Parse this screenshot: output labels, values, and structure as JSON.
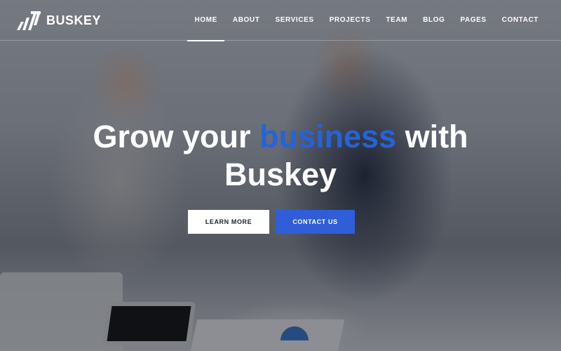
{
  "brand": {
    "name": "BUSKEY"
  },
  "nav": {
    "items": [
      {
        "label": "HOME",
        "active": true
      },
      {
        "label": "ABOUT",
        "active": false
      },
      {
        "label": "SERVICES",
        "active": false
      },
      {
        "label": "PROJECTS",
        "active": false
      },
      {
        "label": "TEAM",
        "active": false
      },
      {
        "label": "BLOG",
        "active": false
      },
      {
        "label": "PAGES",
        "active": false
      },
      {
        "label": "CONTACT",
        "active": false
      }
    ]
  },
  "hero": {
    "title_part1": "Grow your ",
    "title_accent": "business",
    "title_part2": " with",
    "title_line2": "Buskey"
  },
  "buttons": {
    "learn_more": "LEARN MORE",
    "contact_us": "CONTACT US"
  },
  "colors": {
    "accent": "#2563d9",
    "button_primary": "#2f5ed8"
  }
}
